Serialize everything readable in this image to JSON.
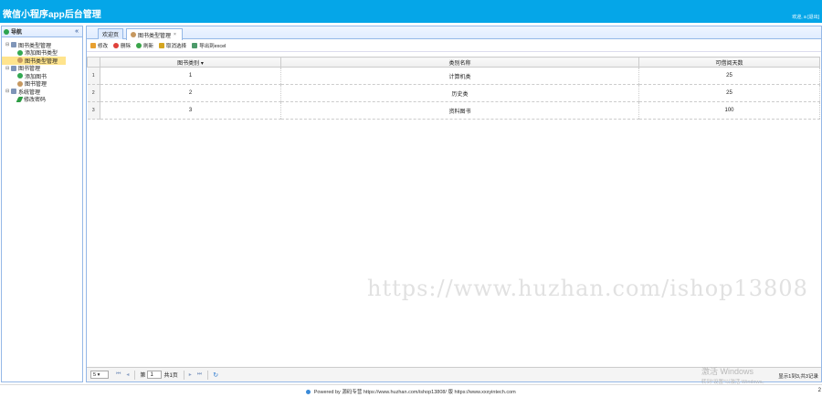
{
  "header": {
    "title": "微信小程序app后台管理",
    "welcome": "欢迎, a [退出]"
  },
  "sidebar": {
    "title": "导航",
    "collapse_icon": "«",
    "tree": [
      {
        "label": "图书类型管理",
        "level": 1,
        "icon": "folder-icon",
        "toggle": "⊟"
      },
      {
        "label": "添加图书类型",
        "level": 2,
        "icon": "add-icon"
      },
      {
        "label": "图书类型管理",
        "level": 2,
        "icon": "user-icon",
        "selected": true
      },
      {
        "label": "图书管理",
        "level": 1,
        "icon": "folder-icon",
        "toggle": "⊟"
      },
      {
        "label": "添加图书",
        "level": 2,
        "icon": "add-icon"
      },
      {
        "label": "图书管理",
        "level": 2,
        "icon": "user-icon"
      },
      {
        "label": "系统管理",
        "level": 1,
        "icon": "folder-icon",
        "toggle": "⊟"
      },
      {
        "label": "修改密码",
        "level": 2,
        "icon": "pen-icon"
      }
    ]
  },
  "tabs": [
    {
      "label": "欢迎页"
    },
    {
      "label": "图书类型管理",
      "close": "×",
      "active": true
    }
  ],
  "toolbar": {
    "edit": "修改",
    "delete": "删除",
    "refresh": "刷新",
    "unselect": "取消选择",
    "export": "导出到excel"
  },
  "table": {
    "columns": [
      "图书类别 ▾",
      "类别名称",
      "可借阅天数"
    ],
    "rows": [
      {
        "rn": "1",
        "id": "1",
        "name": "计算机类",
        "days": "25"
      },
      {
        "rn": "2",
        "id": "2",
        "name": "历史类",
        "days": "25"
      },
      {
        "rn": "3",
        "id": "3",
        "name": "资料图书",
        "days": "100"
      }
    ]
  },
  "pager": {
    "page_size": "5 ▾",
    "first": "⏮",
    "prev": "◂",
    "page_prefix": "第",
    "page_value": "1",
    "page_suffix": "共1页",
    "next": "▸",
    "last": "⏭",
    "reload": "↻",
    "info": "显示1到3,共3记录"
  },
  "watermark": "https://www.huzhan.com/ishop13808",
  "activate": {
    "line1": "激活 Windows",
    "line2": "转到\"设置\"以激活 Windows。"
  },
  "footer": "Powered by 源码专营 https://www.huzhan.com/ishop13808/ 版 https://www.xxxyintech.com",
  "corner": "2"
}
